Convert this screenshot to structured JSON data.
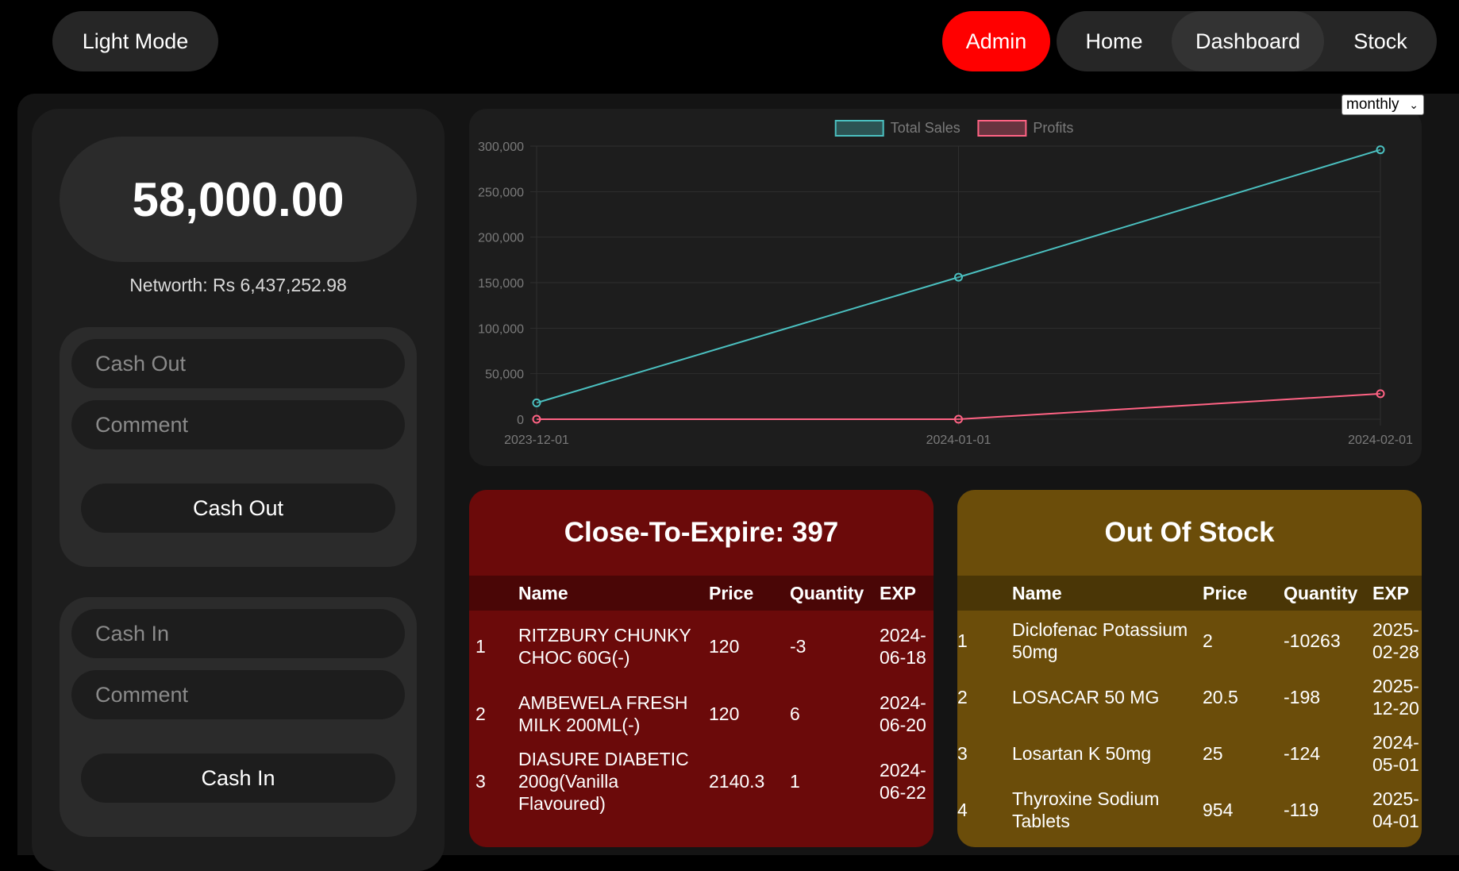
{
  "nav": {
    "theme_toggle": "Light Mode",
    "admin": "Admin",
    "home": "Home",
    "dashboard": "Dashboard",
    "stock": "Stock"
  },
  "balance": {
    "amount": "58,000.00",
    "networth": "Networth: Rs 6,437,252.98"
  },
  "cash_out": {
    "amount_placeholder": "Cash Out",
    "comment_placeholder": "Comment",
    "button": "Cash Out"
  },
  "cash_in": {
    "amount_placeholder": "Cash In",
    "comment_placeholder": "Comment",
    "button": "Cash In"
  },
  "period_select": {
    "selected": "monthly"
  },
  "chart_data": {
    "type": "line",
    "x": [
      "2023-12-01",
      "2024-01-01",
      "2024-02-01"
    ],
    "ylim": [
      0,
      300000
    ],
    "yticks": [
      0,
      50000,
      100000,
      150000,
      200000,
      250000,
      300000
    ],
    "ytick_labels": [
      "0",
      "50,000",
      "100,000",
      "150,000",
      "200,000",
      "250,000",
      "300,000"
    ],
    "grid": true,
    "legend_position": "top-center",
    "series": [
      {
        "name": "Total Sales",
        "values": [
          18000,
          156000,
          296000
        ],
        "color": "#4bc0c0"
      },
      {
        "name": "Profits",
        "values": [
          0,
          0,
          28000
        ],
        "color": "#ff6384"
      }
    ]
  },
  "close_to_expire": {
    "title": "Close-To-Expire: 397",
    "headers": [
      "",
      "Name",
      "Price",
      "Quantity",
      "EXP"
    ],
    "rows": [
      {
        "index": "1",
        "name": "RITZBURY CHUNKY CHOC 60G(-)",
        "price": "120",
        "quantity": "-3",
        "exp": "2024-06-18"
      },
      {
        "index": "2",
        "name": "AMBEWELA FRESH MILK 200ML(-)",
        "price": "120",
        "quantity": "6",
        "exp": "2024-06-20"
      },
      {
        "index": "3",
        "name": "DIASURE DIABETIC 200g(Vanilla Flavoured)",
        "price": "2140.3",
        "quantity": "1",
        "exp": "2024-06-22"
      }
    ]
  },
  "out_of_stock": {
    "title": "Out Of Stock",
    "headers": [
      "",
      "Name",
      "Price",
      "Quantity",
      "EXP"
    ],
    "rows": [
      {
        "index": "1",
        "name": "Diclofenac Potassium 50mg",
        "price": "2",
        "quantity": "-10263",
        "exp": "2025-02-28"
      },
      {
        "index": "2",
        "name": "LOSACAR 50 MG",
        "price": "20.5",
        "quantity": "-198",
        "exp": "2025-12-20"
      },
      {
        "index": "3",
        "name": "Losartan K 50mg",
        "price": "25",
        "quantity": "-124",
        "exp": "2024-05-01"
      },
      {
        "index": "4",
        "name": "Thyroxine Sodium Tablets",
        "price": "954",
        "quantity": "-119",
        "exp": "2025-04-01"
      }
    ]
  }
}
